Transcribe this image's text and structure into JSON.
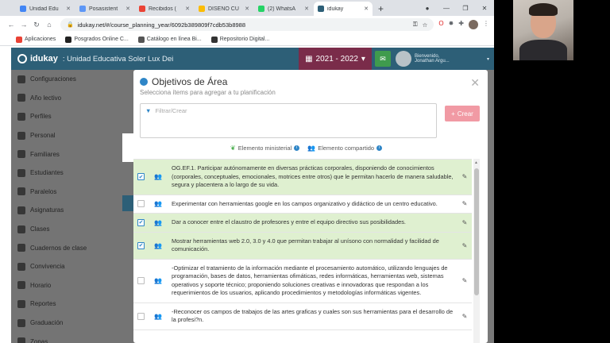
{
  "tabs": [
    {
      "title": "Unidad Edu",
      "color": "#4285f4"
    },
    {
      "title": "Posasistent",
      "color": "#5e97f6"
    },
    {
      "title": "Recibidos (",
      "color": "#ea4335"
    },
    {
      "title": "DISEÑO CU",
      "color": "#fbbc05"
    },
    {
      "title": "(2) WhatsA",
      "color": "#25d366"
    },
    {
      "title": "idukay",
      "color": "#2d5f77"
    }
  ],
  "address": {
    "url": "idukay.net/#/course_planning_year/6092b389809f7cdb53b8988"
  },
  "bookmarks": [
    {
      "label": "Aplicaciones",
      "color": "#e94235"
    },
    {
      "label": "Posgrados Online C...",
      "color": "#222"
    },
    {
      "label": "Catálogo en línea Bi...",
      "color": "#555"
    },
    {
      "label": "Repositorio Digital...",
      "color": "#333"
    }
  ],
  "app": {
    "logo": "idukay",
    "school": ": Unidad Educativa Soler Lux Dei",
    "year": "2021 - 2022",
    "welcome": "Bienvenido,",
    "user": "Jonathan Argu..."
  },
  "sidebar": [
    "Configuraciones",
    "Año lectivo",
    "Perfiles",
    "Personal",
    "Familiares",
    "Estudiantes",
    "Paralelos",
    "Asignaturas",
    "Clases",
    "Cuadernos de clase",
    "Convivencia",
    "Horario",
    "Reportes",
    "Graduación",
    "Zonas"
  ],
  "modal": {
    "title": "Objetivos de Área",
    "subtitle": "Selecciona ítems para agregar a tu planificación",
    "filter_placeholder": "Filtrar/Crear",
    "create_label": "Crear",
    "legend_ministerial": "Elemento ministerial",
    "legend_shared": "Elemento compartido",
    "items": [
      {
        "text": "OG.EF.1. Participar autónomamente en diversas prácticas corporales, disponiendo de conocimientos (corporales, conceptuales, emocionales, motrices entre otros) que le permitan hacerlo de manera saludable, segura y placentera a lo largo de su vida.",
        "selected": true
      },
      {
        "text": "Experimentar con herramientas google en los campos organizativo y didáctico de un centro educativo.",
        "selected": false
      },
      {
        "text": "Dar a conocer entre el claustro de profesores y entre el equipo directivo sus posibilidades.",
        "selected": true
      },
      {
        "text": "Mostrar herramientas web 2.0, 3.0 y 4.0 que permitan trabajar al unísono con normalidad y facilidad de comunicación.",
        "selected": true
      },
      {
        "text": "-Optimizar el tratamiento de la información mediante el procesamiento automático, utilizando lenguajes de programación, bases de datos, herramientas ofimáticas, redes informáticas, herramientas web, sistemas operativos y soporte técnico; proponiendo soluciones creativas e innovadoras que respondan a los requerimientos de los usuarios, aplicando procedimientos y metodologías informáticas vigentes.",
        "selected": false
      },
      {
        "text": "-Reconocer os campos de trabajos de las artes graficas y cuales son sus herramientas para el desarrollo de la profesi?n.",
        "selected": false
      }
    ]
  }
}
